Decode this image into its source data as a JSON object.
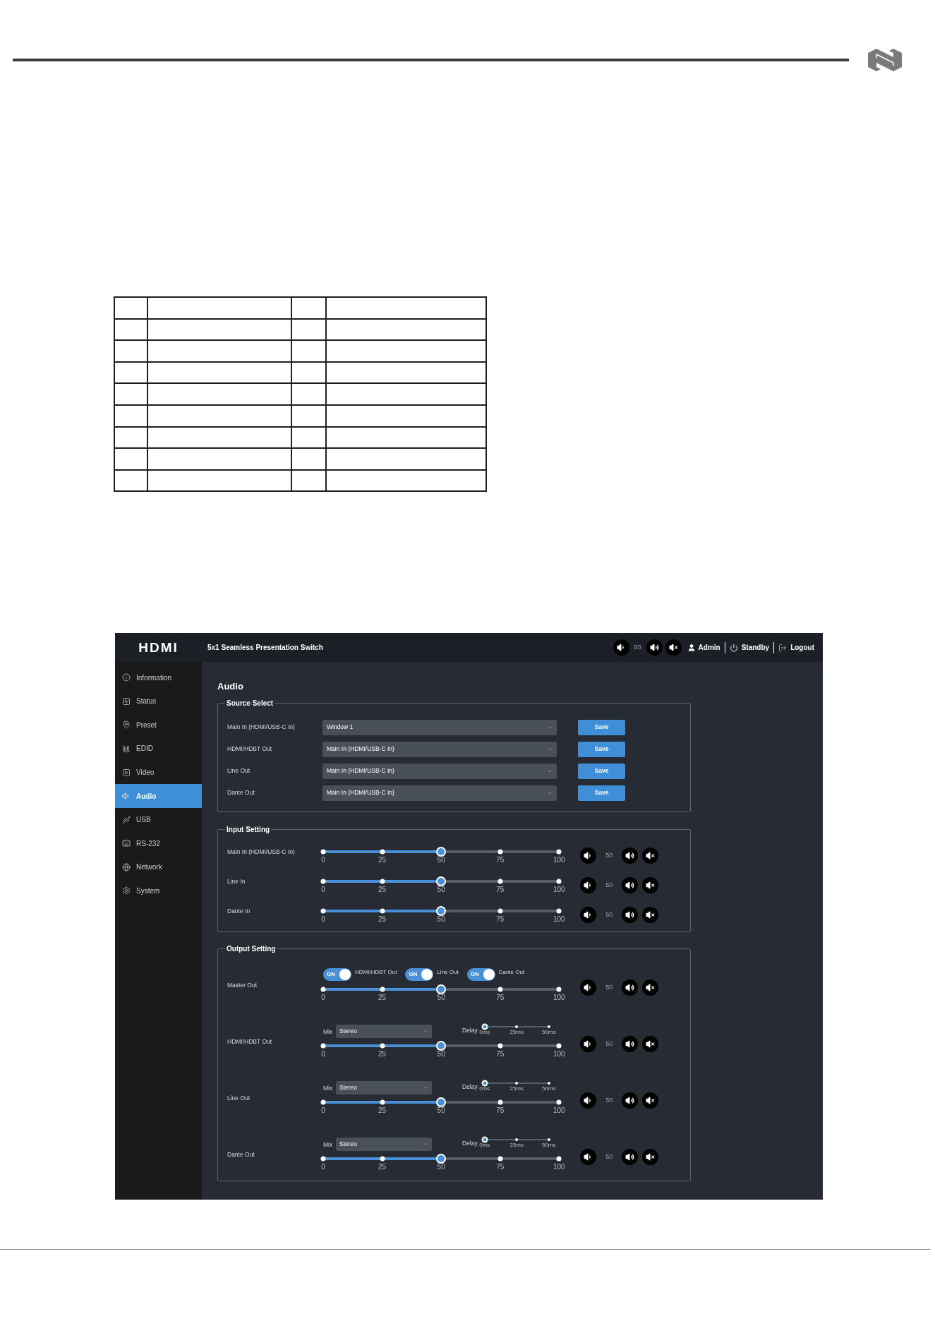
{
  "app": {
    "logo_text": "HDMI",
    "title": "5x1 Seamless Presentation Switch",
    "header": {
      "volume_reading": "50",
      "user": "Admin",
      "standby": "Standby",
      "logout": "Logout"
    },
    "sidebar": [
      {
        "label": "Information",
        "selected": false
      },
      {
        "label": "Status",
        "selected": false
      },
      {
        "label": "Preset",
        "selected": false
      },
      {
        "label": "EDID",
        "selected": false
      },
      {
        "label": "Video",
        "selected": false
      },
      {
        "label": "Audio",
        "selected": true
      },
      {
        "label": "USB",
        "selected": false
      },
      {
        "label": "RS-232",
        "selected": false
      },
      {
        "label": "Network",
        "selected": false
      },
      {
        "label": "System",
        "selected": false
      }
    ],
    "page_title": "Audio",
    "source_select": {
      "title": "Source Select",
      "rows": [
        {
          "label": "Main In (HDMI/USB-C In)",
          "value": "Window 1",
          "button": "Save"
        },
        {
          "label": "HDMI/HDBT Out",
          "value": "Main In (HDMI/USB-C In)",
          "button": "Save"
        },
        {
          "label": "Line Out",
          "value": "Main In (HDMI/USB-C In)",
          "button": "Save"
        },
        {
          "label": "Dante Out",
          "value": "Main In (HDMI/USB-C In)",
          "button": "Save"
        }
      ]
    },
    "input_setting": {
      "title": "Input Setting",
      "rows": [
        {
          "label": "Main In (HDMI/USB-C In)",
          "level": 0.5,
          "ticks": [
            "0",
            "25",
            "50",
            "75",
            "100"
          ],
          "reading": "50"
        },
        {
          "label": "Line In",
          "level": 0.5,
          "ticks": [
            "0",
            "25",
            "50",
            "75",
            "100"
          ],
          "reading": "50"
        },
        {
          "label": "Dante In",
          "level": 0.5,
          "ticks": [
            "0",
            "25",
            "50",
            "75",
            "100"
          ],
          "reading": "50"
        }
      ]
    },
    "output_setting": {
      "title": "Output Setting",
      "rows": [
        {
          "kind": "master",
          "label": "Master Out",
          "toggles": [
            {
              "label": "HDMI/HDBT Out",
              "text": "ON",
              "on": true
            },
            {
              "label": "Line Out",
              "text": "ON",
              "on": true
            },
            {
              "label": "Dante Out",
              "text": "ON",
              "on": true
            }
          ],
          "level": 0.5,
          "ticks": [
            "0",
            "25",
            "50",
            "75",
            "100"
          ],
          "reading": "50"
        },
        {
          "kind": "mix",
          "label": "HDMI/HDBT Out",
          "mix_label": "Mix",
          "mix_value": "Stereo",
          "delay": {
            "label": "Delay",
            "level": 0,
            "ticks": [
              "0ms",
              "25ms",
              "50ms"
            ]
          },
          "level": 0.5,
          "ticks": [
            "0",
            "25",
            "50",
            "75",
            "100"
          ],
          "reading": "50"
        },
        {
          "kind": "mix",
          "label": "Line Out",
          "mix_label": "Mix",
          "mix_value": "Stereo",
          "delay": {
            "label": "Delay",
            "level": 0,
            "ticks": [
              "0ms",
              "25ms",
              "50ms"
            ]
          },
          "level": 0.5,
          "ticks": [
            "0",
            "25",
            "50",
            "75",
            "100"
          ],
          "reading": "50"
        },
        {
          "kind": "mix",
          "label": "Dante Out",
          "mix_label": "Mix",
          "mix_value": "Stereo",
          "delay": {
            "label": "Delay",
            "level": 0,
            "ticks": [
              "0ms",
              "25ms",
              "50ms"
            ]
          },
          "level": 0.5,
          "ticks": [
            "0",
            "25",
            "50",
            "75",
            "100"
          ],
          "reading": "50"
        }
      ]
    }
  }
}
